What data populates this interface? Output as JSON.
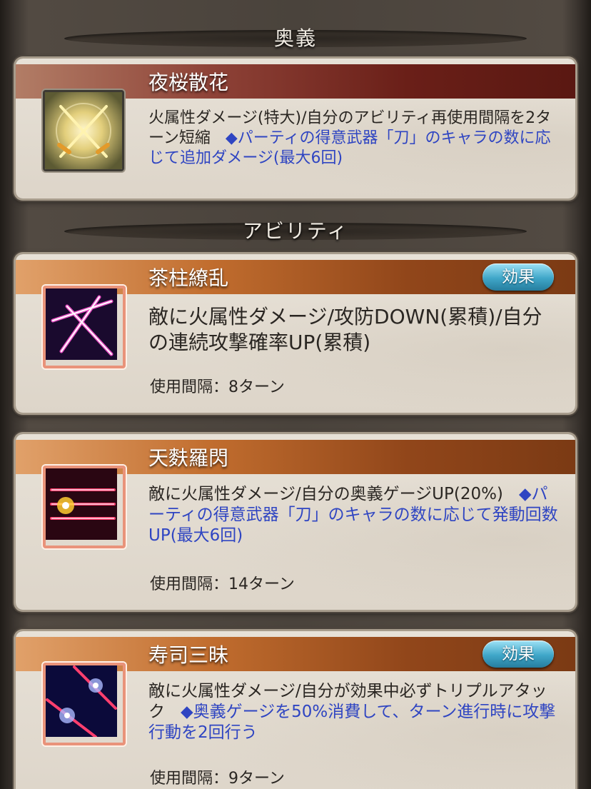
{
  "sections": {
    "ougi_title": "奥義",
    "ability_title": "アビリティ"
  },
  "ougi": {
    "name": "夜桜散花",
    "icon": "crossed-swords-icon",
    "desc_main": "火属性ダメージ(特大)/自分のアビリティ再使用間隔を2ターン短縮",
    "desc_highlight": "◆パーティの得意武器「刀」のキャラの数に応じて追加ダメージ(最大6回)"
  },
  "abilities": [
    {
      "name": "茶柱繚乱",
      "icon": "pink-slash-star-icon",
      "effect_button": "効果",
      "desc_main": "敵に火属性ダメージ/攻防DOWN(累積)/自分の連続攻撃確率UP(累積)",
      "desc_highlight": "",
      "cooldown": "使用間隔：8ターン"
    },
    {
      "name": "天麩羅閃",
      "icon": "red-flash-burst-icon",
      "effect_button": "",
      "desc_main": "敵に火属性ダメージ/自分の奥義ゲージUP(20%)",
      "desc_highlight": "◆パーティの得意武器「刀」のキャラの数に応じて発動回数UP(最大6回)",
      "cooldown": "使用間隔：14ターン"
    },
    {
      "name": "寿司三昧",
      "icon": "blue-sparkle-slash-icon",
      "effect_button": "効果",
      "desc_main": "敵に火属性ダメージ/自分が効果中必ずトリプルアタック",
      "desc_highlight": "◆奥義ゲージを50%消費して、ターン進行時に攻撃行動を2回行う",
      "cooldown": "使用間隔：9ターン"
    }
  ],
  "colors": {
    "highlight_text": "#2f45c2",
    "ougi_namebar": "#6a1f18",
    "ability_namebar": "#c16d2e",
    "effect_button": "#3fa6c8"
  }
}
